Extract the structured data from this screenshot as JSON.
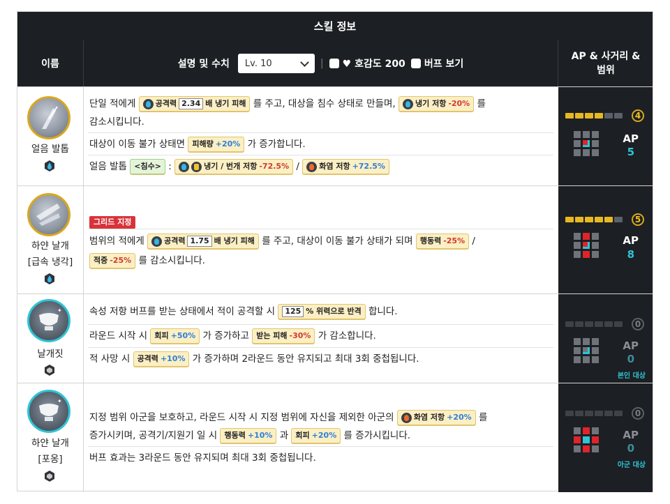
{
  "title": "스킬 정보",
  "header": {
    "name": "이름",
    "desc": "설명 및 수치",
    "level": "Lv. 10",
    "sep": "|",
    "affinity": "♥ 호감도 200",
    "buff": "버프 보기",
    "ap1": "AP & 사거리 &",
    "ap2": "범위"
  },
  "skills": [
    {
      "name1": "얼음 발톱",
      "l1a": "단일 적에게",
      "t1": "공격력",
      "t1n": "2.34",
      "t1b": "배 냉기 피해",
      "l1b": "를 주고, 대상을 침수 상태로 만들며,",
      "t2": "냉기 저항",
      "t2v": "-20%",
      "l1c": "를",
      "l2": "감소시킵니다.",
      "l3a": "대상이 이동 불가 상태면",
      "t3": "피해량",
      "t3v": "+20%",
      "l3b": "가 증가합니다.",
      "l4a": "얼음 발톱",
      "t4": "<침수>",
      "l4b": ":",
      "t5": "냉기 / 번개 저항",
      "t5v": "-72.5%",
      "l4c": "/",
      "t6": "화염 저항",
      "t6v": "+72.5%",
      "ap": "AP",
      "apv": "5",
      "range": "4",
      "bar_filled": 4
    },
    {
      "name1": "하얀 날개",
      "name2": "[급속 냉각]",
      "badge": "그리드 지정",
      "l1a": "범위의 적에게",
      "t1": "공격력",
      "t1n": "1.75",
      "t1b": "배 냉기 피해",
      "l1b": "를 주고, 대상이 이동 불가 상태가 되며",
      "t2": "행동력",
      "t2v": "-25%",
      "l1c": "/",
      "t3": "적중",
      "t3v": "-25%",
      "l2": "를 감소시킵니다.",
      "ap": "AP",
      "apv": "8",
      "range": "5",
      "bar_filled": 5
    },
    {
      "name1": "날개짓",
      "l1a": "속성 저항 버프를 받는 상태에서 적이 공격할 시",
      "t1n": "125",
      "t1b": "% 위력으로 반격",
      "l1b": "합니다.",
      "l2a": "라운드 시작 시",
      "t2": "회피",
      "t2v": "+50%",
      "l2b": "가 증가하고",
      "t3": "받는 피해",
      "t3v": "-30%",
      "l2c": "가 감소합니다.",
      "l3a": "적 사망 시",
      "t4": "공격력",
      "t4v": "+10%",
      "l3b": "가 증가하며 2라운드 동안 유지되고 최대 3회 중첩됩니다.",
      "ap": "AP",
      "apv": "0",
      "range": "0",
      "target": "본인 대상"
    },
    {
      "name1": "하얀 날개",
      "name2": "[포옹]",
      "l1a": "지정 범위 아군을 보호하고, 라운드 시작 시 지정 범위에 자신을 제외한 아군의",
      "t1": "화염 저항",
      "t1v": "+20%",
      "l1b": "를",
      "l2a": "증가시키며, 공격기/지원기 일 시",
      "t2": "행동력",
      "t2v": "+10%",
      "l2b": "과",
      "t3": "회피",
      "t3v": "+20%",
      "l2c": "를 증가시킵니다.",
      "l3": "버프 효과는 3라운드 동안 유지되며 최대 3회 중첩됩니다.",
      "ap": "AP",
      "apv": "0",
      "range": "0",
      "target": "아군 대상"
    }
  ]
}
